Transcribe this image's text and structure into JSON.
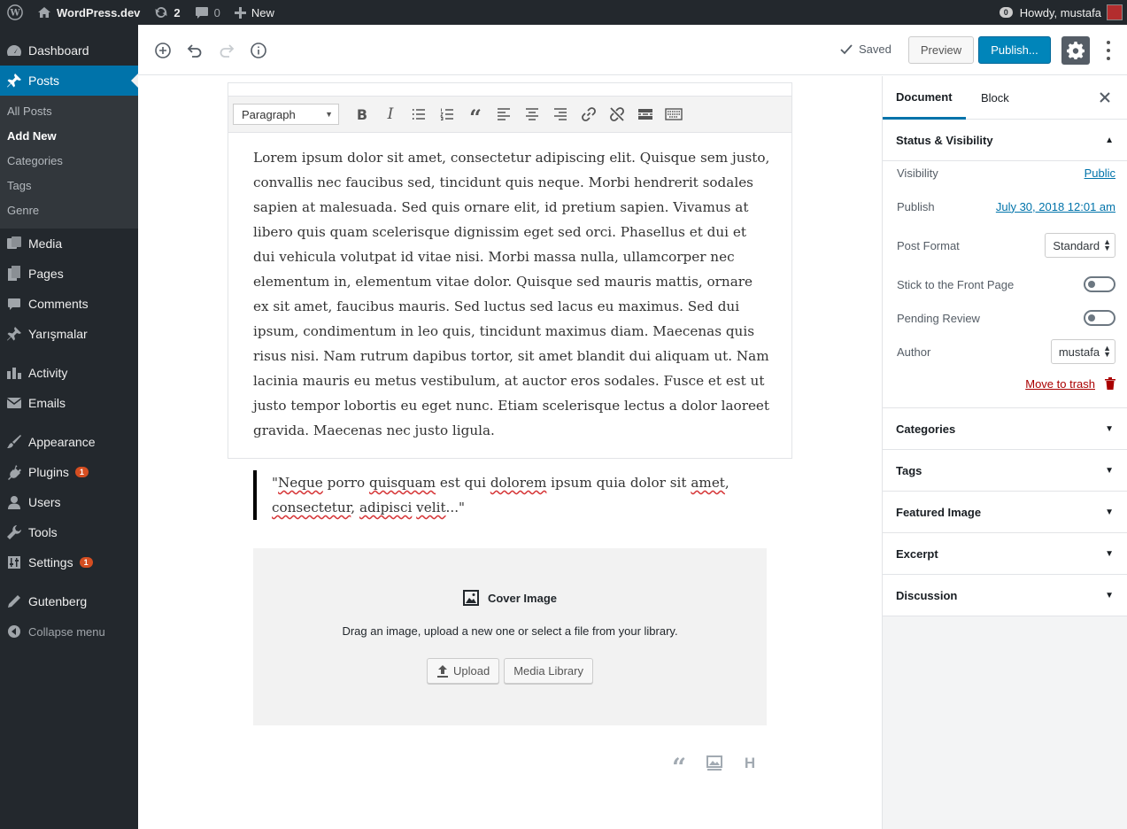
{
  "admin_bar": {
    "site_name": "WordPress.dev",
    "updates_count": "2",
    "comments_count": "0",
    "new_label": "New",
    "notifications_count": "0",
    "greeting": "Howdy, mustafa"
  },
  "sidebar": {
    "dashboard": "Dashboard",
    "posts": "Posts",
    "posts_sub": [
      "All Posts",
      "Add New",
      "Categories",
      "Tags",
      "Genre"
    ],
    "media": "Media",
    "pages": "Pages",
    "comments": "Comments",
    "yarismalar": "Yarışmalar",
    "activity": "Activity",
    "emails": "Emails",
    "appearance": "Appearance",
    "plugins": "Plugins",
    "plugins_badge": "1",
    "users": "Users",
    "tools": "Tools",
    "settings": "Settings",
    "settings_badge": "1",
    "gutenberg": "Gutenberg",
    "collapse": "Collapse menu"
  },
  "header": {
    "saved_label": "Saved",
    "preview_label": "Preview",
    "publish_label": "Publish..."
  },
  "editor": {
    "format_select": "Paragraph",
    "paragraph": "Lorem ipsum dolor sit amet, consectetur adipiscing elit. Quisque sem justo, convallis nec faucibus sed, tincidunt quis neque. Morbi hendrerit sodales sapien at malesuada. Sed quis ornare elit, id pretium sapien. Vivamus at libero quis quam scelerisque dignissim eget sed orci. Phasellus et dui et dui vehicula volutpat id vitae nisi. Morbi massa nulla, ullamcorper nec elementum in, elementum vitae dolor. Quisque sed mauris mattis, ornare ex sit amet, faucibus mauris. Sed luctus sed lacus eu maximus. Sed dui ipsum, condimentum in leo quis, tincidunt maximus diam. Maecenas quis risus nisi. Nam rutrum dapibus tortor, sit amet blandit dui aliquam ut. Nam lacinia mauris eu metus vestibulum, at auctor eros sodales. Fusce et est ut justo tempor lobortis eu eget nunc. Etiam scelerisque lectus a dolor laoreet gravida. Maecenas nec justo ligula.",
    "quote": {
      "open": "\"",
      "w1": "Neque",
      "s1": " porro ",
      "w2": "quisquam",
      "s2": " est qui ",
      "w3": "dolorem",
      "s3": " ipsum quia dolor sit ",
      "w4": "amet",
      "s4": ",",
      "w5": "consectetur",
      "s5": ", ",
      "w6": "adipisci",
      "s6": " ",
      "w7": "velit",
      "close": "...\""
    },
    "cover": {
      "title": "Cover Image",
      "description": "Drag an image, upload a new one or select a file from your library.",
      "upload_label": "Upload",
      "media_library_label": "Media Library"
    },
    "shortcut_heading": "H"
  },
  "panel": {
    "tab_document": "Document",
    "tab_block": "Block",
    "status_title": "Status & Visibility",
    "visibility_label": "Visibility",
    "visibility_value": "Public",
    "publish_label": "Publish",
    "publish_value": "July 30, 2018 12:01 am",
    "post_format_label": "Post Format",
    "post_format_value": "Standard",
    "sticky_label": "Stick to the Front Page",
    "sticky_on": false,
    "pending_label": "Pending Review",
    "pending_on": false,
    "author_label": "Author",
    "author_value": "mustafa",
    "trash_label": "Move to trash",
    "sections": [
      "Categories",
      "Tags",
      "Featured Image",
      "Excerpt",
      "Discussion"
    ]
  },
  "colors": {
    "admin_dark": "#23282d",
    "accent_blue": "#0073aa",
    "publish_blue": "#0085ba",
    "badge_red": "#d54e21",
    "trash_red": "#a00"
  }
}
